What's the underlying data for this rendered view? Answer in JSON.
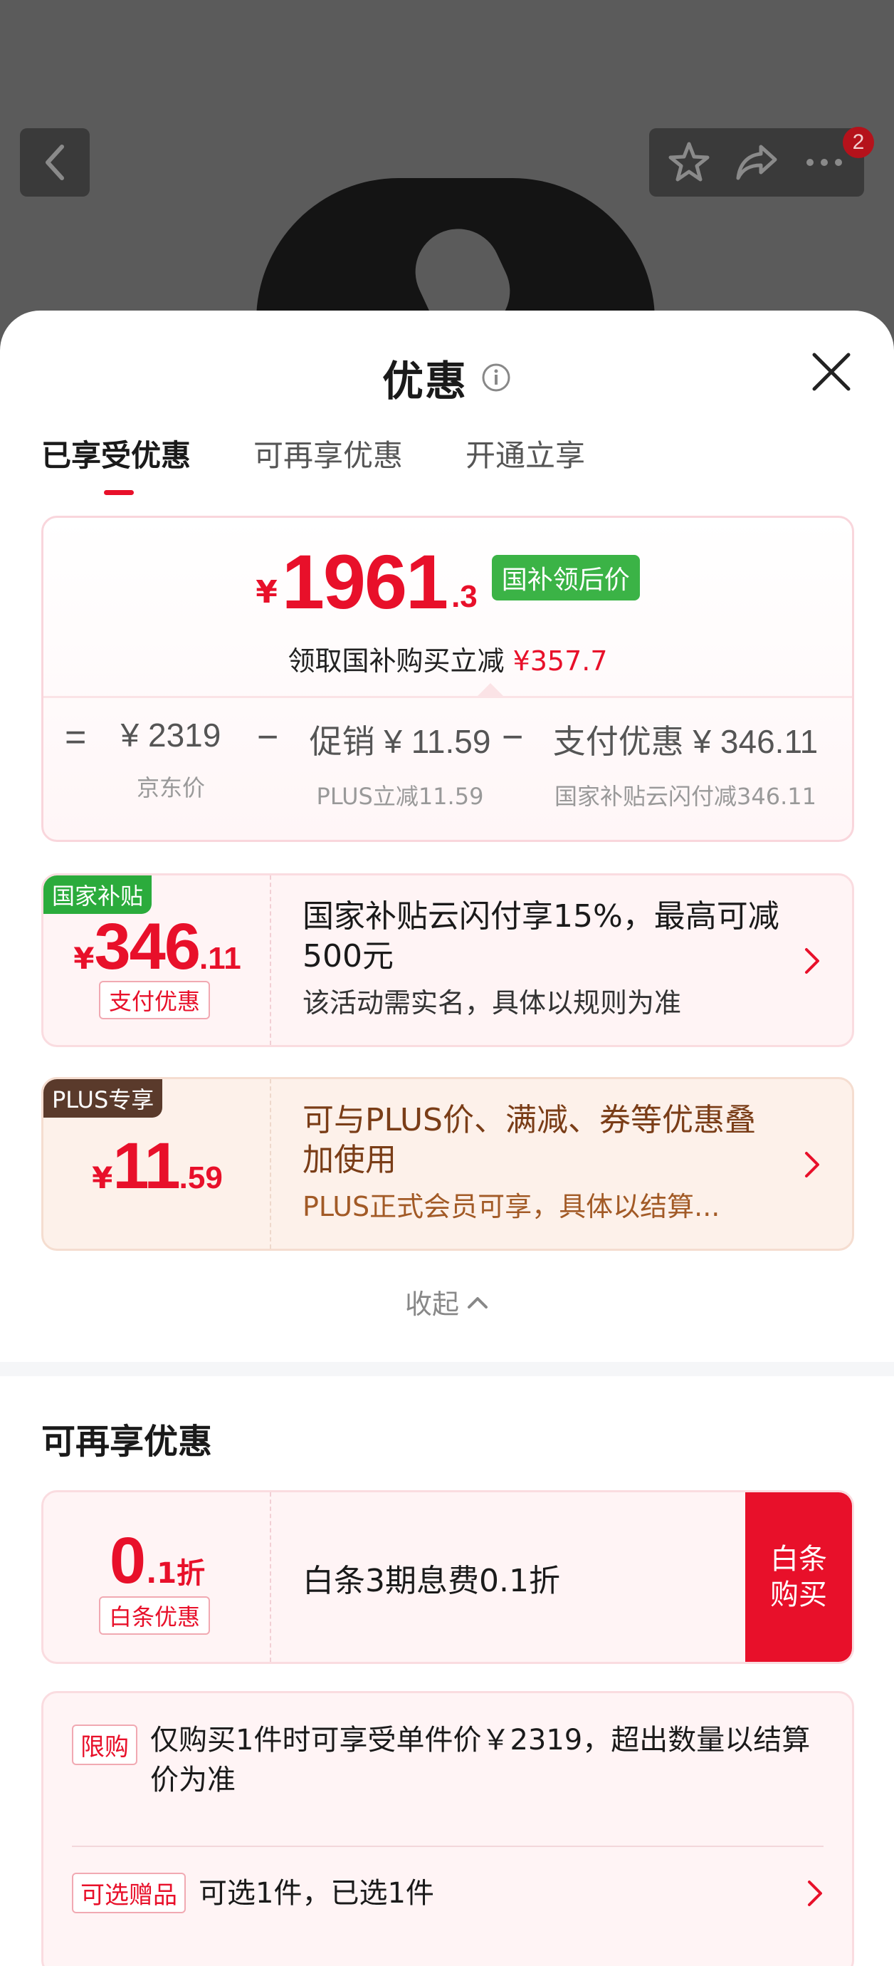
{
  "background": {
    "cart_badge": "2"
  },
  "sheet": {
    "title": "优惠",
    "tabs": [
      {
        "label": "已享受优惠"
      },
      {
        "label": "可再享优惠"
      },
      {
        "label": "开通立享"
      }
    ]
  },
  "summary": {
    "currency": "¥",
    "price_main": "1961",
    "price_decimal": ".3",
    "price_tag": "国补领后价",
    "save_text": "领取国补购买立减",
    "save_amount": "¥357.7",
    "breakdown": {
      "equals": "=",
      "jd_price": "¥ 2319",
      "jd_price_label": "京东价",
      "minus1": "−",
      "promo": "促销 ¥ 11.59",
      "promo_label": "PLUS立减11.59",
      "minus2": "−",
      "payment": "支付优惠 ¥ 346.11",
      "payment_label": "国家补贴云闪付减346.11"
    }
  },
  "discounts": [
    {
      "ribbon": "国家补贴",
      "currency": "¥",
      "amount_main": "346",
      "amount_decimal": ".11",
      "pill": "支付优惠",
      "main_text": "国家补贴云闪付享15%，最高可减500元",
      "sub_text": "该活动需实名，具体以规则为准"
    },
    {
      "ribbon": "PLUS专享",
      "currency": "¥",
      "amount_main": "11",
      "amount_decimal": ".59",
      "main_text": "可与PLUS价、满减、券等优惠叠加使用",
      "sub_text": "PLUS正式会员可享，具体以结算..."
    }
  ],
  "collapse_label": "收起",
  "more_section": {
    "title": "可再享优惠",
    "baitiao": {
      "amount_main": "0",
      "amount_decimal": ".1折",
      "pill": "白条优惠",
      "main_text": "白条3期息费0.1折",
      "buy_label": "白条购买"
    },
    "info": [
      {
        "tag": "限购",
        "text": "仅购买1件时可享受单件价￥2319，超出数量以结算价为准"
      },
      {
        "tag": "可选赠品",
        "text": "可选1件，已选1件"
      }
    ]
  },
  "colors": {
    "accent_red": "#e8102a",
    "green_tag": "#3bb346",
    "plus_brown": "#5a3a2b"
  }
}
